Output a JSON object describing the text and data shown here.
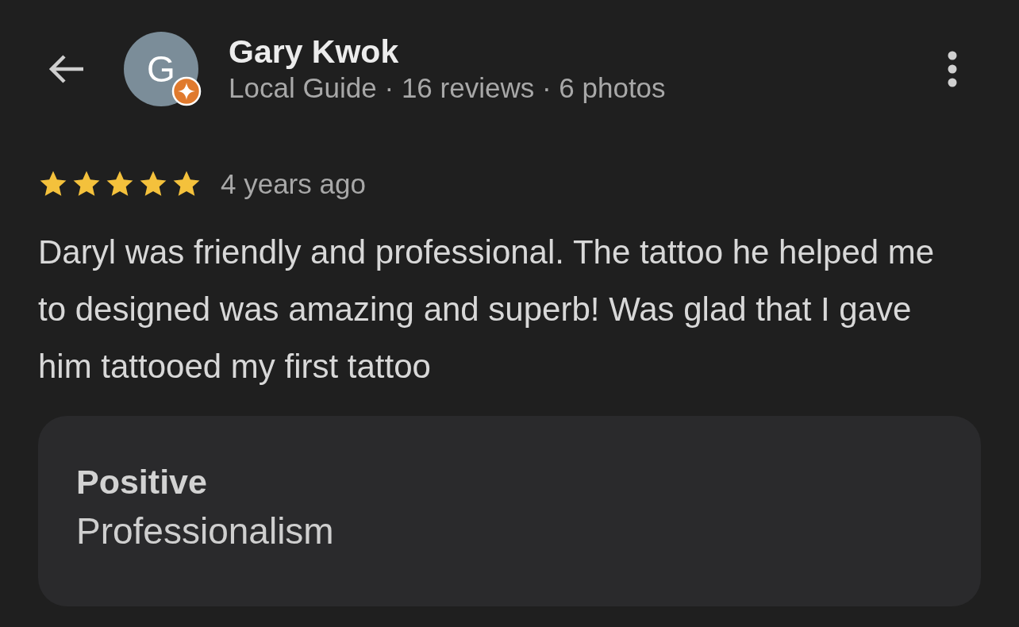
{
  "reviewer": {
    "initial": "G",
    "name": "Gary Kwok",
    "details": "Local Guide · 16 reviews · 6 photos",
    "local_guide": true
  },
  "review": {
    "stars": 5,
    "time": "4 years ago",
    "text": "Daryl was friendly and professional. The tattoo he helped me to designed was amazing and superb! Was glad that I gave him tattooed my first tattoo"
  },
  "highlights": {
    "title": "Positive",
    "items": [
      "Professionalism"
    ]
  }
}
